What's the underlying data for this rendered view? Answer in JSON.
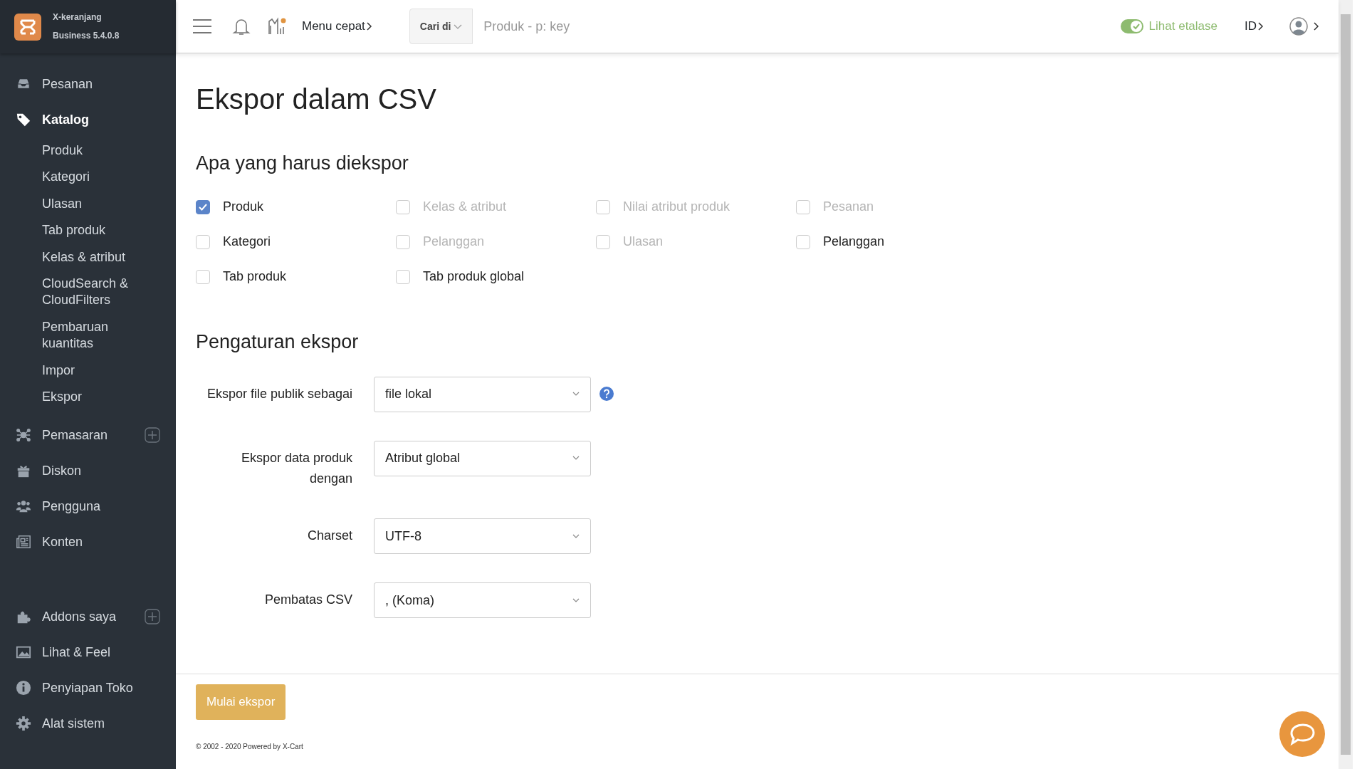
{
  "brand": {
    "name": "X-keranjang",
    "version": "Business 5.4.0.8"
  },
  "header": {
    "quick_menu": "Menu cepat",
    "search_scope": "Cari di",
    "search_placeholder": "Produk - p: key",
    "storefront": {
      "label": "Lihat etalase",
      "on": true
    },
    "language": "ID",
    "notification_dot": true
  },
  "sidebar": {
    "items": [
      {
        "label": "Pesanan",
        "selected": false,
        "add": false
      },
      {
        "label": "Katalog",
        "selected": true,
        "add": false,
        "children": [
          {
            "label": "Produk"
          },
          {
            "label": "Kategori"
          },
          {
            "label": "Ulasan"
          },
          {
            "label": "Tab produk"
          },
          {
            "label": "Kelas & atribut"
          },
          {
            "label": "CloudSearch & CloudFilters"
          },
          {
            "label": "Pembaruan kuantitas"
          },
          {
            "label": "Impor"
          },
          {
            "label": "Ekspor"
          }
        ]
      },
      {
        "label": "Pemasaran",
        "selected": false,
        "add": true
      },
      {
        "label": "Diskon",
        "selected": false,
        "add": false
      },
      {
        "label": "Pengguna",
        "selected": false,
        "add": false
      },
      {
        "label": "Konten",
        "selected": false,
        "add": false
      },
      {
        "label": "Addons saya",
        "selected": false,
        "add": true
      },
      {
        "label": "Lihat & Feel",
        "selected": false,
        "add": false
      },
      {
        "label": "Penyiapan Toko",
        "selected": false,
        "add": false
      },
      {
        "label": "Alat sistem",
        "selected": false,
        "add": false
      }
    ]
  },
  "title": "Ekspor dalam CSV",
  "what_section": {
    "heading": "Apa yang harus diekspor",
    "options": [
      {
        "label": "Produk",
        "checked": true,
        "disabled": false
      },
      {
        "label": "Kelas & atribut",
        "checked": false,
        "disabled": true
      },
      {
        "label": "Nilai atribut produk",
        "checked": false,
        "disabled": true
      },
      {
        "label": "Pesanan",
        "checked": false,
        "disabled": true
      },
      {
        "label": "Kategori",
        "checked": false,
        "disabled": false
      },
      {
        "label": "Pelanggan",
        "checked": false,
        "disabled": true
      },
      {
        "label": "Ulasan",
        "checked": false,
        "disabled": true
      },
      {
        "label": "Pelanggan",
        "checked": false,
        "disabled": false
      },
      {
        "label": "Tab produk",
        "checked": false,
        "disabled": false
      },
      {
        "label": "Tab produk global",
        "checked": false,
        "disabled": false
      }
    ]
  },
  "settings_section": {
    "heading": "Pengaturan ekspor",
    "fields": [
      {
        "label": "Ekspor file publik sebagai",
        "value": "file lokal",
        "help": true
      },
      {
        "label": "Ekspor data produk dengan",
        "value": "Atribut global",
        "help": false
      },
      {
        "label": "Charset",
        "value": "UTF-8",
        "help": false
      },
      {
        "label": "Pembatas CSV",
        "value": ", (Koma)",
        "help": false
      }
    ]
  },
  "start_button": "Mulai ekspor",
  "footer": "© 2002 - 2020 Powered by X-Cart"
}
